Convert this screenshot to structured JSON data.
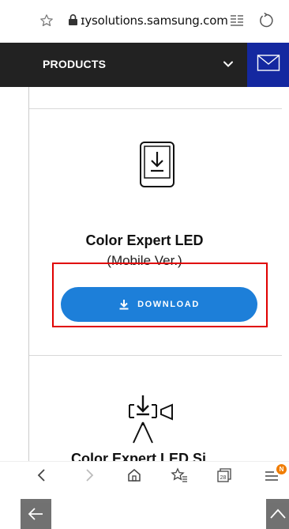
{
  "browser": {
    "url": "ɪysolutions.samsung.com",
    "icons": [
      "star-icon",
      "lock-icon",
      "reader-mode-icon",
      "reload-icon"
    ]
  },
  "nav": {
    "label": "PRODUCTS",
    "icons": [
      "chevron-down-icon",
      "mail-icon"
    ],
    "colors": {
      "bar": "#222222",
      "mail_box": "#1428a0"
    }
  },
  "product": {
    "title": "Color Expert LED",
    "subtitle": "(Mobile Ver.)",
    "download_label": "DOWNLOAD",
    "icon": "tablet-download-icon",
    "button_color": "#1d7fd9"
  },
  "next_product": {
    "title": "Color Expert LED Si...",
    "icon": "camera-download-icon"
  },
  "floating": {
    "icons": [
      "back-arrow-icon",
      "scroll-up-icon"
    ]
  },
  "bottom_nav": {
    "tab_count": "28",
    "badge": "N",
    "icons": [
      "back-icon",
      "forward-icon",
      "home-icon",
      "bookmarks-icon",
      "tabs-icon",
      "menu-icon"
    ]
  },
  "highlight_color": "#e00000"
}
